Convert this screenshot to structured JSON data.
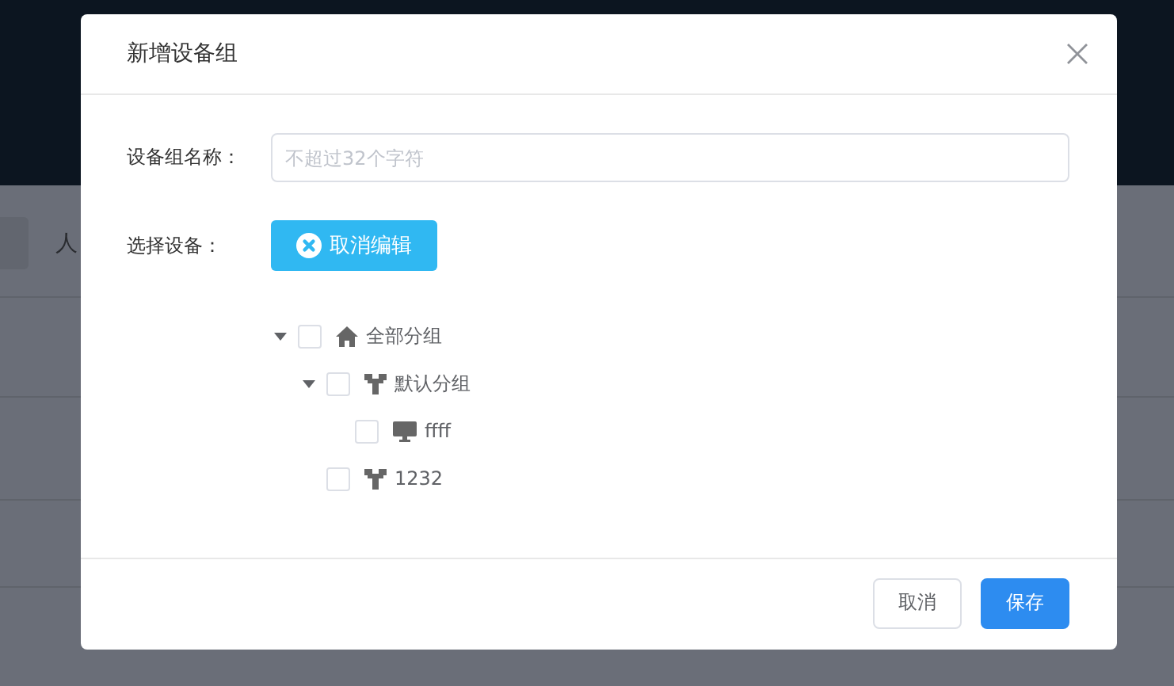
{
  "background_page": {
    "label": "人"
  },
  "dialog": {
    "title": "新增设备组",
    "fields": [
      {
        "label": "设备组名称：",
        "placeholder": "不超过32个字符"
      }
    ],
    "device_label": "选择设备：",
    "cancel_edit_button": "取消编辑",
    "tree": [
      {
        "label": "全部分组",
        "kind": "home",
        "checked": false,
        "expanded": true,
        "children": [
          {
            "label": "默认分组",
            "kind": "group",
            "checked": false,
            "expanded": true,
            "children": [
              {
                "label": "ffff",
                "kind": "device",
                "checked": false
              }
            ]
          },
          {
            "label": "1232",
            "kind": "group",
            "checked": false
          }
        ]
      }
    ],
    "buttons": [
      {
        "label": "取消",
        "kind": "default"
      },
      {
        "label": "保存",
        "kind": "primary"
      }
    ]
  }
}
